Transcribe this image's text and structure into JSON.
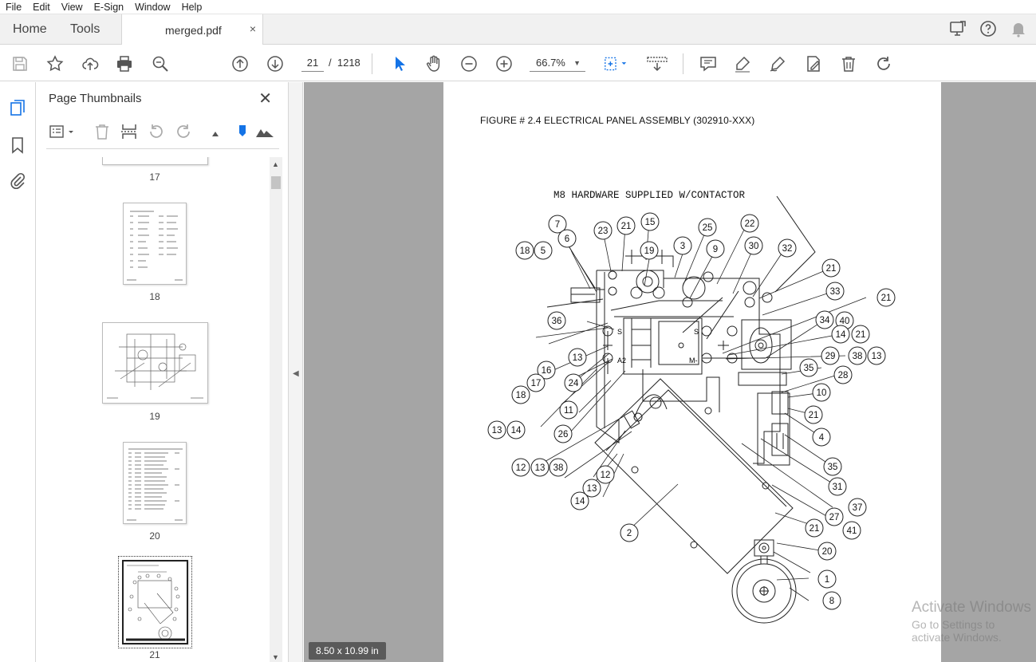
{
  "menu": [
    "File",
    "Edit",
    "View",
    "E-Sign",
    "Window",
    "Help"
  ],
  "tabs": {
    "home": "Home",
    "tools": "Tools",
    "document": "merged.pdf",
    "close": "×"
  },
  "toolbar": {
    "page_current": "21",
    "page_sep": "/",
    "page_total": "1218",
    "zoom": "66.7%"
  },
  "panel": {
    "title": "Page Thumbnails",
    "close": "✕",
    "thumbnails": [
      {
        "label": "17"
      },
      {
        "label": "18"
      },
      {
        "label": "19"
      },
      {
        "label": "20"
      },
      {
        "label": "21"
      }
    ]
  },
  "document": {
    "figure_title": "FIGURE # 2.4 ELECTRICAL PANEL ASSEMBLY (302910-XXX)",
    "note": "M8 HARDWARE SUPPLIED W/CONTACTOR",
    "part_callouts": [
      "7",
      "6",
      "23",
      "21",
      "15",
      "25",
      "22",
      "30",
      "32",
      "18",
      "5",
      "19",
      "3",
      "9",
      "21",
      "33",
      "21",
      "36",
      "40",
      "34",
      "13",
      "14",
      "21",
      "29",
      "38",
      "13",
      "16",
      "35",
      "28",
      "17",
      "24",
      "10",
      "18",
      "11",
      "21",
      "13",
      "14",
      "26",
      "4",
      "12",
      "13",
      "38",
      "12",
      "35",
      "13",
      "31",
      "14",
      "37",
      "2",
      "27",
      "21",
      "41",
      "20",
      "1",
      "8"
    ],
    "labels": {
      "s1": "S",
      "s2": "S",
      "a2": "A2",
      "m": "M-"
    }
  },
  "status": {
    "page_size": "8.50 x 10.99 in"
  },
  "watermark": {
    "line1": "Activate Windows",
    "line2": "Go to Settings to activate Windows."
  },
  "colors": {
    "accent": "#1473e6",
    "doc_bg": "#a5a5a5"
  }
}
